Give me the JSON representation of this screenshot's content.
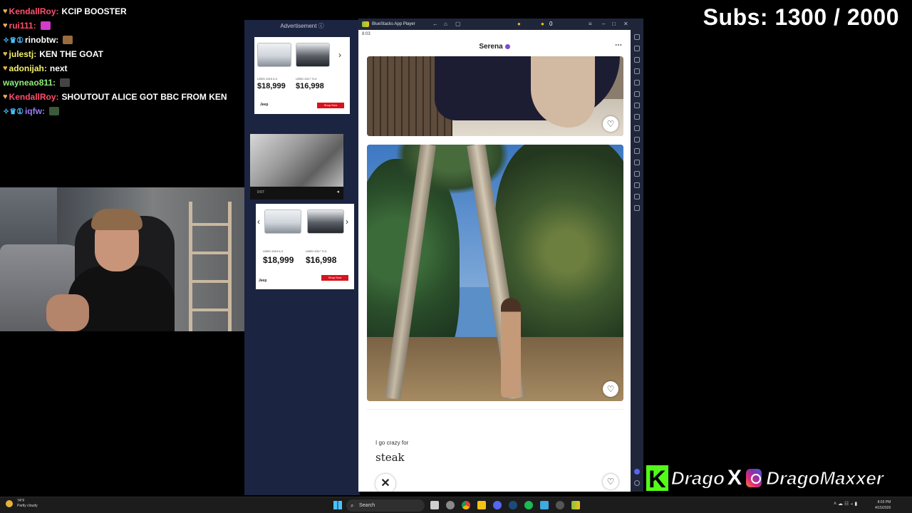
{
  "chat": {
    "messages": [
      {
        "user": "KendallRoy:",
        "text": "KCIP BOOSTER",
        "color": "#ff4f6d",
        "badges": "♥"
      },
      {
        "user": "rui111:",
        "text": "",
        "color": "#ff4f6d",
        "badges": "♥",
        "emote_color": "#d23cc8"
      },
      {
        "user": "rinobtw:",
        "text": "",
        "color": "#ffffff",
        "badges": "✧♛①",
        "emote_color": "#9a6b3e"
      },
      {
        "user": "julestj:",
        "text": "KEN THE GOAT",
        "color": "#f6f06b",
        "badges": "♥"
      },
      {
        "user": "adonijah:",
        "text": "next",
        "color": "#f6f06b",
        "badges": "♥"
      },
      {
        "user": "wayneao811:",
        "text": "",
        "color": "#8ef07a",
        "badges": "",
        "emote_color": "#444444"
      },
      {
        "user": "KendallRoy:",
        "text": "SHOUTOUT ALICE GOT BBC FROM KEN",
        "color": "#ff4f6d",
        "badges": "♥"
      },
      {
        "user": "iqfw:",
        "text": "",
        "color": "#9b7bff",
        "badges": "✧♛①",
        "emote_color": "#3b5a3a"
      }
    ]
  },
  "ad": {
    "header": "Advertisement ⓘ",
    "cards": [
      {
        "price_left": "$18,999",
        "price_right": "$16,998",
        "label_left": "USED 2019 ILX",
        "label_right": "USED 2017 TLX",
        "shop": "Shop Now",
        "brand": "Jeep"
      },
      {
        "price_left": "$18,999",
        "price_right": "$16,998",
        "label_left": "USED 2019 ILX",
        "label_right": "USED 2017 TLX",
        "shop": "Shop Now",
        "brand": "Jeep"
      }
    ],
    "video_time": "0:07"
  },
  "emulator": {
    "title": "BlueStacks App Player",
    "status_time": "8:03",
    "coin_count": "0",
    "profile_name": "Serena",
    "more_icon": "⋯",
    "heart_icon": "♡",
    "close_icon": "✕",
    "prompt_question": "I go crazy for",
    "prompt_answer": "steak"
  },
  "overlay": {
    "subs": "Subs: 1300 / 2000",
    "kick_letter": "K",
    "kick_handle": "Drago",
    "x_letter": "X",
    "ig_handle": "DragoMaxxer",
    "accent_kick": "#53fc18"
  },
  "taskbar": {
    "weather_temp": "74°F",
    "weather_desc": "Partly cloudy",
    "search_label": "Search",
    "search_icon": "⌕",
    "tray": "˄  ☁  ☷  ⍆  ▮",
    "clock_time": "8:03 PM",
    "clock_date": "4/15/2026"
  }
}
